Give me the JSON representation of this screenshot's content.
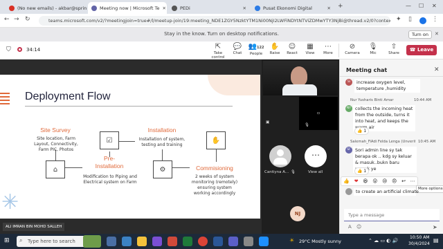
{
  "browser": {
    "tabs": [
      {
        "label": "(No new emails) - akbar@sprin",
        "active": false,
        "color": "#d93025"
      },
      {
        "label": "Meeting now | Microsoft Te",
        "active": true,
        "color": "#6264a7"
      },
      {
        "label": "PEDi",
        "active": false,
        "color": "#555555"
      },
      {
        "label": "Pusat Ekonomi Digital",
        "active": false,
        "color": "#2c7be5"
      }
    ],
    "url": "teams.microsoft.com/v2/?meetingjoin=true#/l/meetup-join/19:meeting_NDE1ZGY5NzktYTM1Ni00NjI2LWFiNDYtNTViZDMwYTY3NjBi@thread.v2/0?context=%7b\"T...",
    "info_message": "Stay in the know. Turn on desktop notifications.",
    "turn_on_label": "Turn on"
  },
  "toolbar": {
    "timer": "34:14",
    "items": [
      {
        "label": "Take control",
        "icon": "take-control-icon",
        "glyph": "⇱"
      },
      {
        "label": "Chat",
        "icon": "chat-icon",
        "glyph": "💬"
      },
      {
        "label": "People",
        "icon": "people-icon",
        "glyph": "👥",
        "badge": "122"
      },
      {
        "label": "Raise",
        "icon": "raise-hand-icon",
        "glyph": "✋"
      },
      {
        "label": "React",
        "icon": "react-icon",
        "glyph": "☺"
      },
      {
        "label": "View",
        "icon": "view-icon",
        "glyph": "▦"
      },
      {
        "label": "More",
        "icon": "more-icon",
        "glyph": "⋯"
      }
    ],
    "camera_label": "Camera",
    "mic_label": "Mic",
    "share_label": "Share",
    "leave_label": "Leave"
  },
  "slide": {
    "title": "Deployment Flow",
    "steps": [
      {
        "title": "Site Survey",
        "desc": "Site location, Farm Layout, Connectivity, Farm PIC, Photos"
      },
      {
        "title": "Pre-\nInstallation",
        "desc": "Modification to Piping and Electrical system on Farm"
      },
      {
        "title": "Installation",
        "desc": "Installation of system, testing and training"
      },
      {
        "title": "Commisioning",
        "desc": "2 weeks of system monitoring (remotely) ensuring system working accordingly"
      }
    ],
    "presenter": "ALI IMRAN BIN MOHD SALLEH"
  },
  "videos": {
    "participant_name": "Cantiyna A...",
    "view_all_label": "View all",
    "nj_initials": "NJ"
  },
  "chat": {
    "title": "Meeting chat",
    "messages": [
      {
        "initials": "SI",
        "sender": "",
        "time": "",
        "text": "increase oxygen level, temperature ,humidity"
      },
      {
        "initials": "NY",
        "sender": "Nur Yusharis Binti Amar",
        "time": "10:44 AM",
        "text": "collects the incoming heat from the outside, turns it into heat, and keeps the warm air",
        "reaction": "👍 1"
      },
      {
        "initials": "SF",
        "sender": "Salemah_FiAdi Felda Lenga (Unverified)",
        "time": "10:45 AM",
        "text": "Sori admin line sy tak berapa ok .. kdg sy keluar & masuk..bukn baru masuk ye",
        "reaction": "👍 1"
      },
      {
        "initials": "",
        "sender": "",
        "time": "",
        "text": "to create an artificial climate"
      }
    ],
    "reactions_bar": [
      "👍",
      "❤",
      "😆",
      "😮",
      "😢",
      "😠",
      "↩",
      "⋯"
    ],
    "more_options_tooltip": "More options",
    "compose_placeholder": "Type a message"
  },
  "taskbar": {
    "search_placeholder": "Type here to search",
    "weather": "29°C  Mostly sunny",
    "time": "10:50 AM",
    "date": "30/4/2024"
  }
}
